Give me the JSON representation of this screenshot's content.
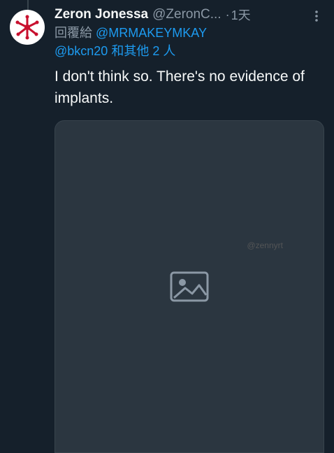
{
  "tweet": {
    "display_name": "Zeron Jonessa",
    "handle": "@ZeronC...",
    "separator": "·",
    "time": "1天",
    "reply_prefix": "回覆給",
    "reply_mention_1": "@MRMAKEYMKAY",
    "reply_mention_2": "@bkcn20",
    "reply_suffix": "和其他 2 人",
    "text": "I don't think so. There's no evidence of implants.",
    "media": {
      "watermark": "@zennyrt"
    }
  },
  "colors": {
    "background": "#15202b",
    "accent": "#1d9bf0",
    "secondary_text": "#8b98a5"
  },
  "icons": {
    "more": "more-dots-icon",
    "avatar": "red-emblem-avatar",
    "media": "image-placeholder-icon"
  }
}
